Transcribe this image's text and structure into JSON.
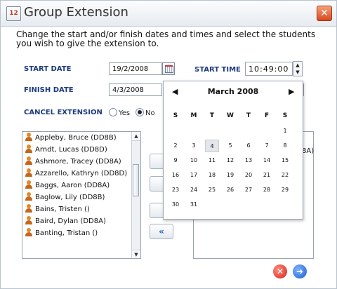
{
  "window": {
    "title": "Group Extension",
    "app_icon_text": "12"
  },
  "instructions": "Change the start and/or finish dates and times and select the students you wish to give the extension to.",
  "form": {
    "start_date_label": "START DATE",
    "start_date_value": "19/2/2008",
    "start_time_label": "START TIME",
    "start_time_value": "10:49:00",
    "finish_date_label": "FINISH DATE",
    "finish_date_value": "4/3/2008",
    "cancel_extension_label": "CANCEL EXTENSION",
    "cancel_options": [
      "Yes",
      "No"
    ],
    "cancel_selected": "No"
  },
  "student_list": [
    "Appleby, Bruce (DD8B)",
    "Arndt, Lucas (DD8D)",
    "Ashmore, Tracey (DD8A)",
    "Azzarello, Kathryn (DD8D)",
    "Baggs, Aaron (DD8A)",
    "Baglow, Lily (DD8B)",
    "Bains, Tristen ()",
    "Baird, Dylan (DD8A)",
    "Banting, Tristan ()"
  ],
  "selected_list_fragment": "8A)",
  "calendar": {
    "month_title": "March 2008",
    "prev_symbol": "◀",
    "next_symbol": "▶",
    "weekdays": [
      "S",
      "M",
      "T",
      "W",
      "T",
      "F",
      "S"
    ],
    "weeks": [
      [
        "",
        "",
        "",
        "",
        "",
        "",
        "1"
      ],
      [
        "2",
        "3",
        "4",
        "5",
        "6",
        "7",
        "8"
      ],
      [
        "9",
        "10",
        "11",
        "12",
        "13",
        "14",
        "15"
      ],
      [
        "16",
        "17",
        "18",
        "19",
        "20",
        "21",
        "22"
      ],
      [
        "23",
        "24",
        "25",
        "26",
        "27",
        "28",
        "29"
      ],
      [
        "30",
        "31",
        "",
        "",
        "",
        "",
        ""
      ]
    ],
    "selected_day": "4"
  },
  "icons": {
    "app": "calendar-app-icon",
    "close": "close-icon",
    "cancel": "cancel-circle-icon",
    "next": "next-arrow-icon",
    "move_left": "double-left-arrow-icon"
  },
  "colors": {
    "label_blue": "#1d3a7d",
    "close_orange": "#d84a1f",
    "cancel_red": "#d3261b",
    "next_blue": "#1b5fd0"
  }
}
